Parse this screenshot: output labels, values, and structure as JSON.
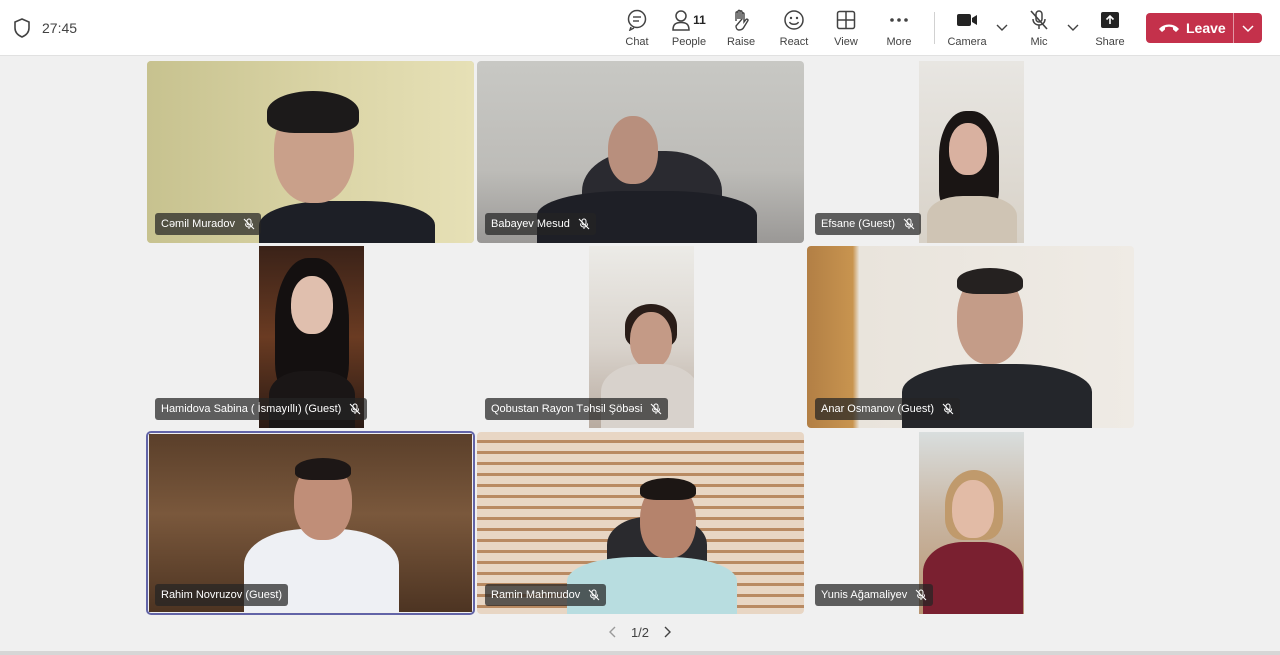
{
  "meeting": {
    "timer": "27:45"
  },
  "toolbar": {
    "chat_label": "Chat",
    "people_label": "People",
    "people_count": "11",
    "raise_label": "Raise",
    "react_label": "React",
    "view_label": "View",
    "more_label": "More",
    "camera_label": "Camera",
    "mic_label": "Mic",
    "share_label": "Share",
    "leave_label": "Leave"
  },
  "participants": [
    {
      "name": "Cəmil Muradov",
      "muted": true
    },
    {
      "name": "Babayev Mesud",
      "muted": true
    },
    {
      "name": "Efsane (Guest)",
      "muted": true
    },
    {
      "name": "Hamidova Sabina ( İsmayıllı) (Guest)",
      "muted": true
    },
    {
      "name": "Qobustan Rayon Təhsil Şöbəsi",
      "muted": true
    },
    {
      "name": "Anar Osmanov (Guest)",
      "muted": true
    },
    {
      "name": "Rahim Novruzov (Guest)",
      "muted": false,
      "active_speaker": true
    },
    {
      "name": "Ramin Mahmudov",
      "muted": true
    },
    {
      "name": "Yunis Ağamaliyev",
      "muted": true
    }
  ],
  "pager": {
    "text": "1/2"
  },
  "colors": {
    "leave": "#c4314b",
    "active_outline": "#6264a7",
    "background": "#f0f0f0"
  },
  "icons": [
    "shield-icon",
    "chat-icon",
    "people-icon",
    "raise-hand-icon",
    "react-icon",
    "view-icon",
    "more-icon",
    "camera-icon",
    "mic-off-icon",
    "share-icon",
    "phone-icon",
    "chevron-down-icon",
    "mic-muted-icon",
    "chevron-left-icon",
    "chevron-right-icon"
  ]
}
